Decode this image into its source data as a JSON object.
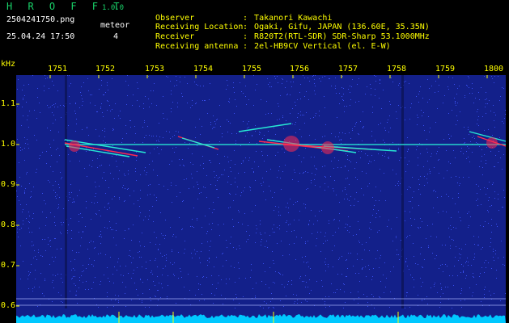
{
  "header": {
    "brand": "H R O F F T",
    "version": "1.0.0",
    "filename": "2504241750.png",
    "timestamp": "25.04.24 17:50",
    "meteor_label": "meteor",
    "meteor_count": "4"
  },
  "info": [
    {
      "key": "Observer",
      "value": "Takanori Kawachi"
    },
    {
      "key": "Receiving Location",
      "value": "Ogaki, Gifu, JAPAN (136.60E, 35.35N)"
    },
    {
      "key": "Receiver",
      "value": "R820T2(RTL-SDR) SDR-Sharp 53.1000MHz"
    },
    {
      "key": "Receiving antenna",
      "value": "2el-HB9CV Vertical (el. E-W)"
    }
  ],
  "chart_data": {
    "type": "heatmap",
    "ylabel": "kHz",
    "x_ticks": [
      "1751",
      "1752",
      "1753",
      "1754",
      "1755",
      "1756",
      "1757",
      "1758",
      "1759",
      "1800"
    ],
    "y_ticks": [
      "1.1",
      "1.0",
      "0.9",
      "0.8",
      "0.7",
      "0.6"
    ],
    "y_tick_values": [
      1.1,
      1.0,
      0.9,
      0.8,
      0.7,
      0.6
    ],
    "carrier_khz": 1.0,
    "colors": {
      "background": "#13208a",
      "noise": "#3f57ff",
      "signal": "#27e8d4",
      "hot": "#ff2a50",
      "baseline": "#00c8ff",
      "tick": "#ffff00",
      "grid": "#aab4ff"
    }
  }
}
